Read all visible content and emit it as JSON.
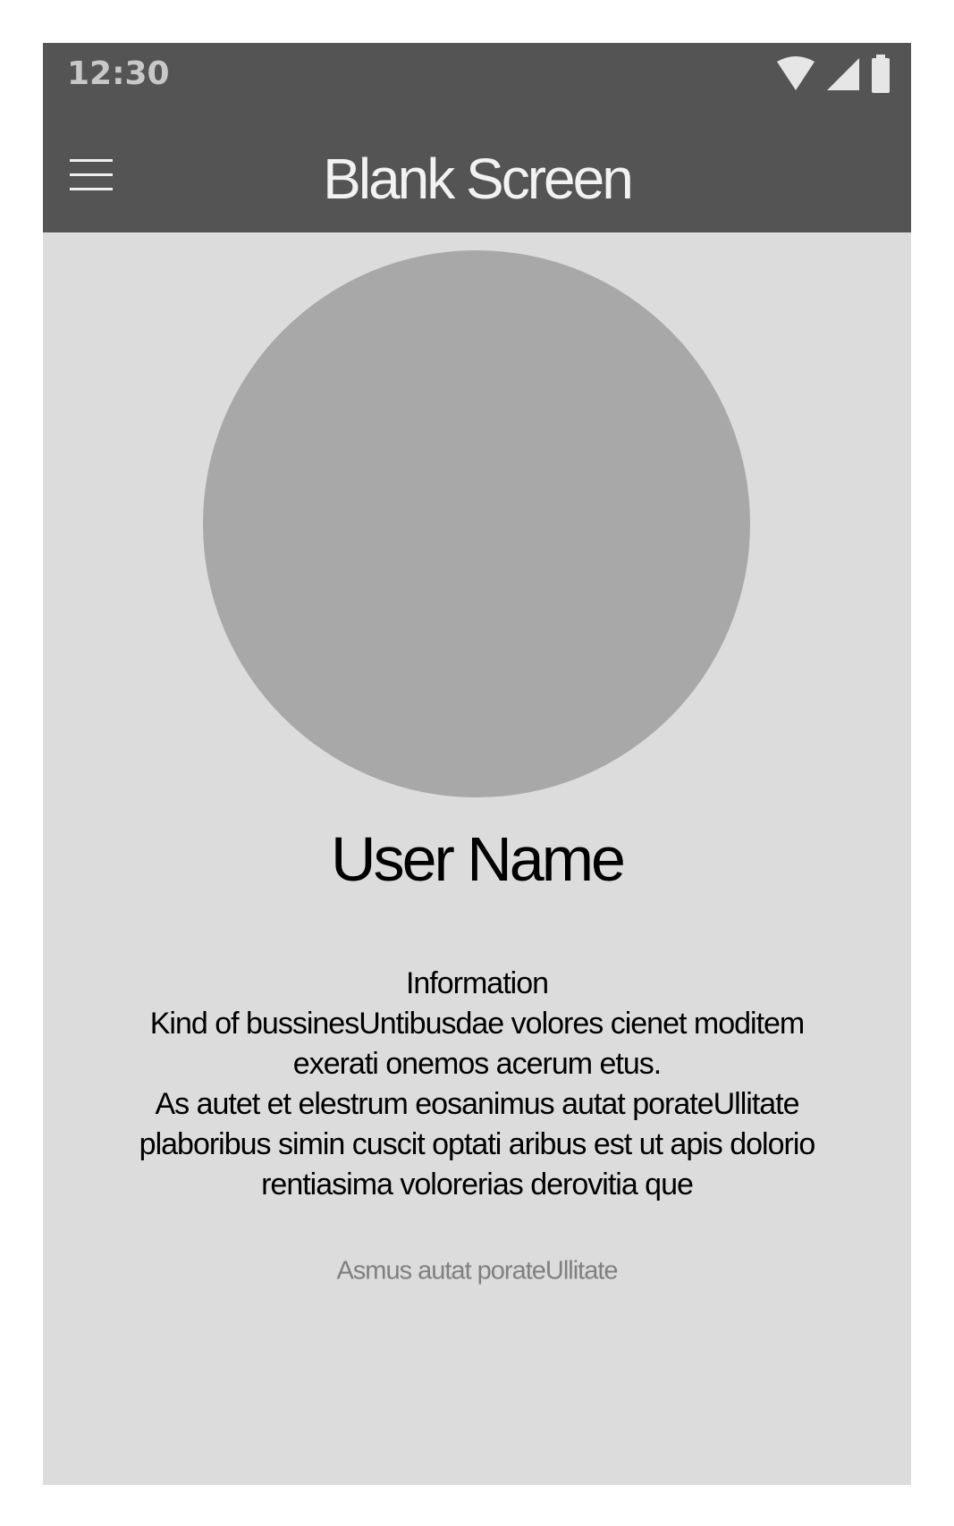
{
  "status_bar": {
    "time": "12:30",
    "icons": [
      "wifi-icon",
      "cellular-signal-icon",
      "battery-icon"
    ]
  },
  "app_bar": {
    "menu_icon": "hamburger-menu-icon",
    "title": "Blank Screen"
  },
  "profile": {
    "avatar": "avatar-placeholder",
    "user_name": "User Name",
    "info_lines": [
      "Information",
      "Kind of bussinesUntibusdae volores cienet moditem",
      "exerati onemos acerum etus.",
      "As autet et elestrum eosanimus autat porateUllitate",
      "plaboribus simin cuscit optati aribus est ut apis dolorio",
      "rentiasima volorerias derovitia que"
    ],
    "caption": "Asmus autat porateUllitate"
  },
  "colors": {
    "app_bar": "#545454",
    "background": "#dcdcdc",
    "avatar": "#a8a8a8",
    "status_text": "#c8c8c8",
    "caption_text": "#808080"
  }
}
